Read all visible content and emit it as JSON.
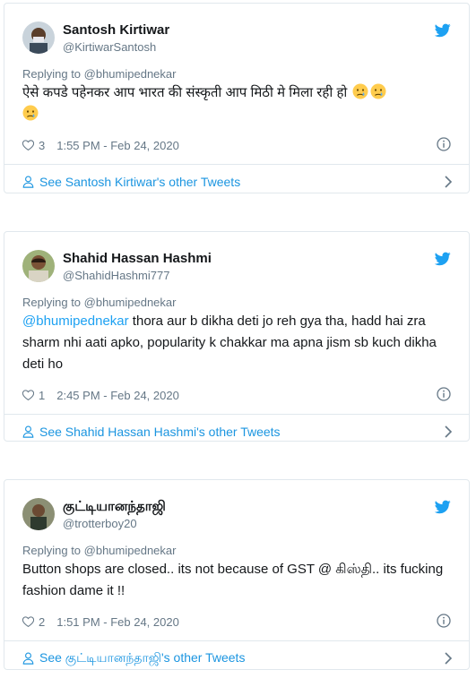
{
  "tweets": [
    {
      "name": "Santosh Kirtiwar",
      "handle": "@KirtiwarSantosh",
      "replying": "Replying to @bhumipednekar",
      "text_prefix": "",
      "text": "ऐसे कपडे पहेनकर आप भारत की संस्कृती आप मिठी मे मिला रही हो",
      "emojis": [
        "crying-face",
        "crying-face",
        "crying-face"
      ],
      "likes": "3",
      "time": "1:55 PM - Feb 24, 2020",
      "footer": "See Santosh Kirtiwar's other Tweets"
    },
    {
      "name": "Shahid Hassan Hashmi",
      "handle": "@ShahidHashmi777",
      "replying": "Replying to @bhumipednekar",
      "text_prefix": "@bhumipednekar",
      "text": " thora aur b dikha deti jo reh gya tha, hadd hai zra sharm nhi aati apko, popularity k chakkar ma apna jism sb kuch dikha deti ho",
      "likes": "1",
      "time": "2:45 PM - Feb 24, 2020",
      "footer": "See Shahid Hassan Hashmi's other Tweets"
    },
    {
      "name": "குட்டியானந்தாஜி",
      "handle": "@trotterboy20",
      "replying": "Replying to @bhumipednekar",
      "text_prefix": "",
      "text": "Button shops are closed..  its not because of GST @ கிஸ்தி..  its fucking fashion dame it !!",
      "likes": "2",
      "time": "1:51 PM - Feb 24, 2020",
      "footer": "See குட்டியானந்தாஜி's other Tweets"
    }
  ],
  "icons": {
    "bird": "twitter-bird-icon",
    "heart": "heart-icon",
    "info": "info-icon",
    "person": "person-icon",
    "chevron": "chevron-right-icon"
  },
  "colors": {
    "twitter_blue": "#1da1f2",
    "link_blue": "#1b95e0",
    "secondary_text": "#657786",
    "border": "#e1e8ed"
  }
}
